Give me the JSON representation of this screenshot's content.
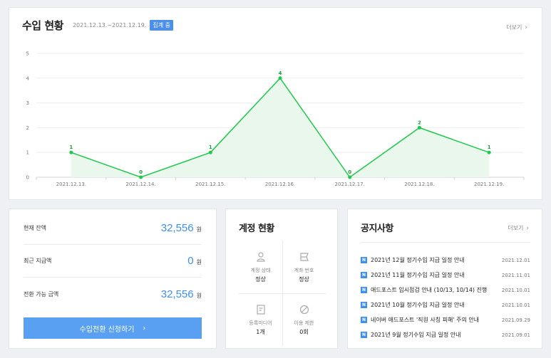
{
  "revenue": {
    "title": "수입 현황",
    "period": "2021.12.13.~2021.12.19.",
    "badge": "집계 중",
    "more_label": "더보기",
    "accent_color": "#1ec84a"
  },
  "chart_data": {
    "type": "area",
    "title": "",
    "xlabel": "",
    "ylabel": "",
    "categories": [
      "2021.12.13.",
      "2021.12.14.",
      "2021.12.15.",
      "2021.12.16.",
      "2021.12.17.",
      "2021.12.18.",
      "2021.12.19."
    ],
    "values": [
      1,
      0,
      1,
      4,
      0,
      2,
      1
    ],
    "ylim": [
      0,
      5
    ],
    "yticks": [
      0,
      1,
      2,
      3,
      4,
      5
    ],
    "grid": true,
    "data_labels": true,
    "line_color": "#1ec84a",
    "fill_color": "#e9f7ec"
  },
  "balance": {
    "rows": [
      {
        "label": "현재 잔액",
        "value": "32,556",
        "unit": "원"
      },
      {
        "label": "최근 지급액",
        "value": "0",
        "unit": "원"
      },
      {
        "label": "전환 가능 금액",
        "value": "32,556",
        "unit": "원"
      }
    ],
    "button_label": "수입전환 신청하기",
    "button_color": "#5aa0f2",
    "value_color": "#3d8ff0"
  },
  "account": {
    "title": "계정 현황",
    "cells": [
      {
        "label": "계정 상태",
        "value": "정상",
        "icon": "user-icon"
      },
      {
        "label": "계좌 번호",
        "value": "정상",
        "icon": "card-icon"
      },
      {
        "label": "등록미디어",
        "value": "1개",
        "icon": "document-icon"
      },
      {
        "label": "이용 제한",
        "value": "0회",
        "icon": "prohibited-icon"
      }
    ]
  },
  "notice": {
    "title": "공지사항",
    "more_label": "더보기",
    "badge_letter": "N",
    "items": [
      {
        "text": "2021년 12월 정기수입 지급 일정 안내",
        "date": "2021.12.01"
      },
      {
        "text": "2021년 11월 정기수입 지급 일정 안내",
        "date": "2021.11.01"
      },
      {
        "text": "애드포스트 임시점검 안내 (10/13, 10/14) 진행",
        "date": "2021.10.01"
      },
      {
        "text": "2021년 10월 정기수입 지급 일정 안내",
        "date": "2021.10.01"
      },
      {
        "text": "네이버 애드포스트 '직원 사칭 피해' 주의 안내",
        "date": "2021.09.29"
      },
      {
        "text": "2021년 9월 정기수입 지급 일정 안내",
        "date": "2021.09.01"
      }
    ]
  }
}
